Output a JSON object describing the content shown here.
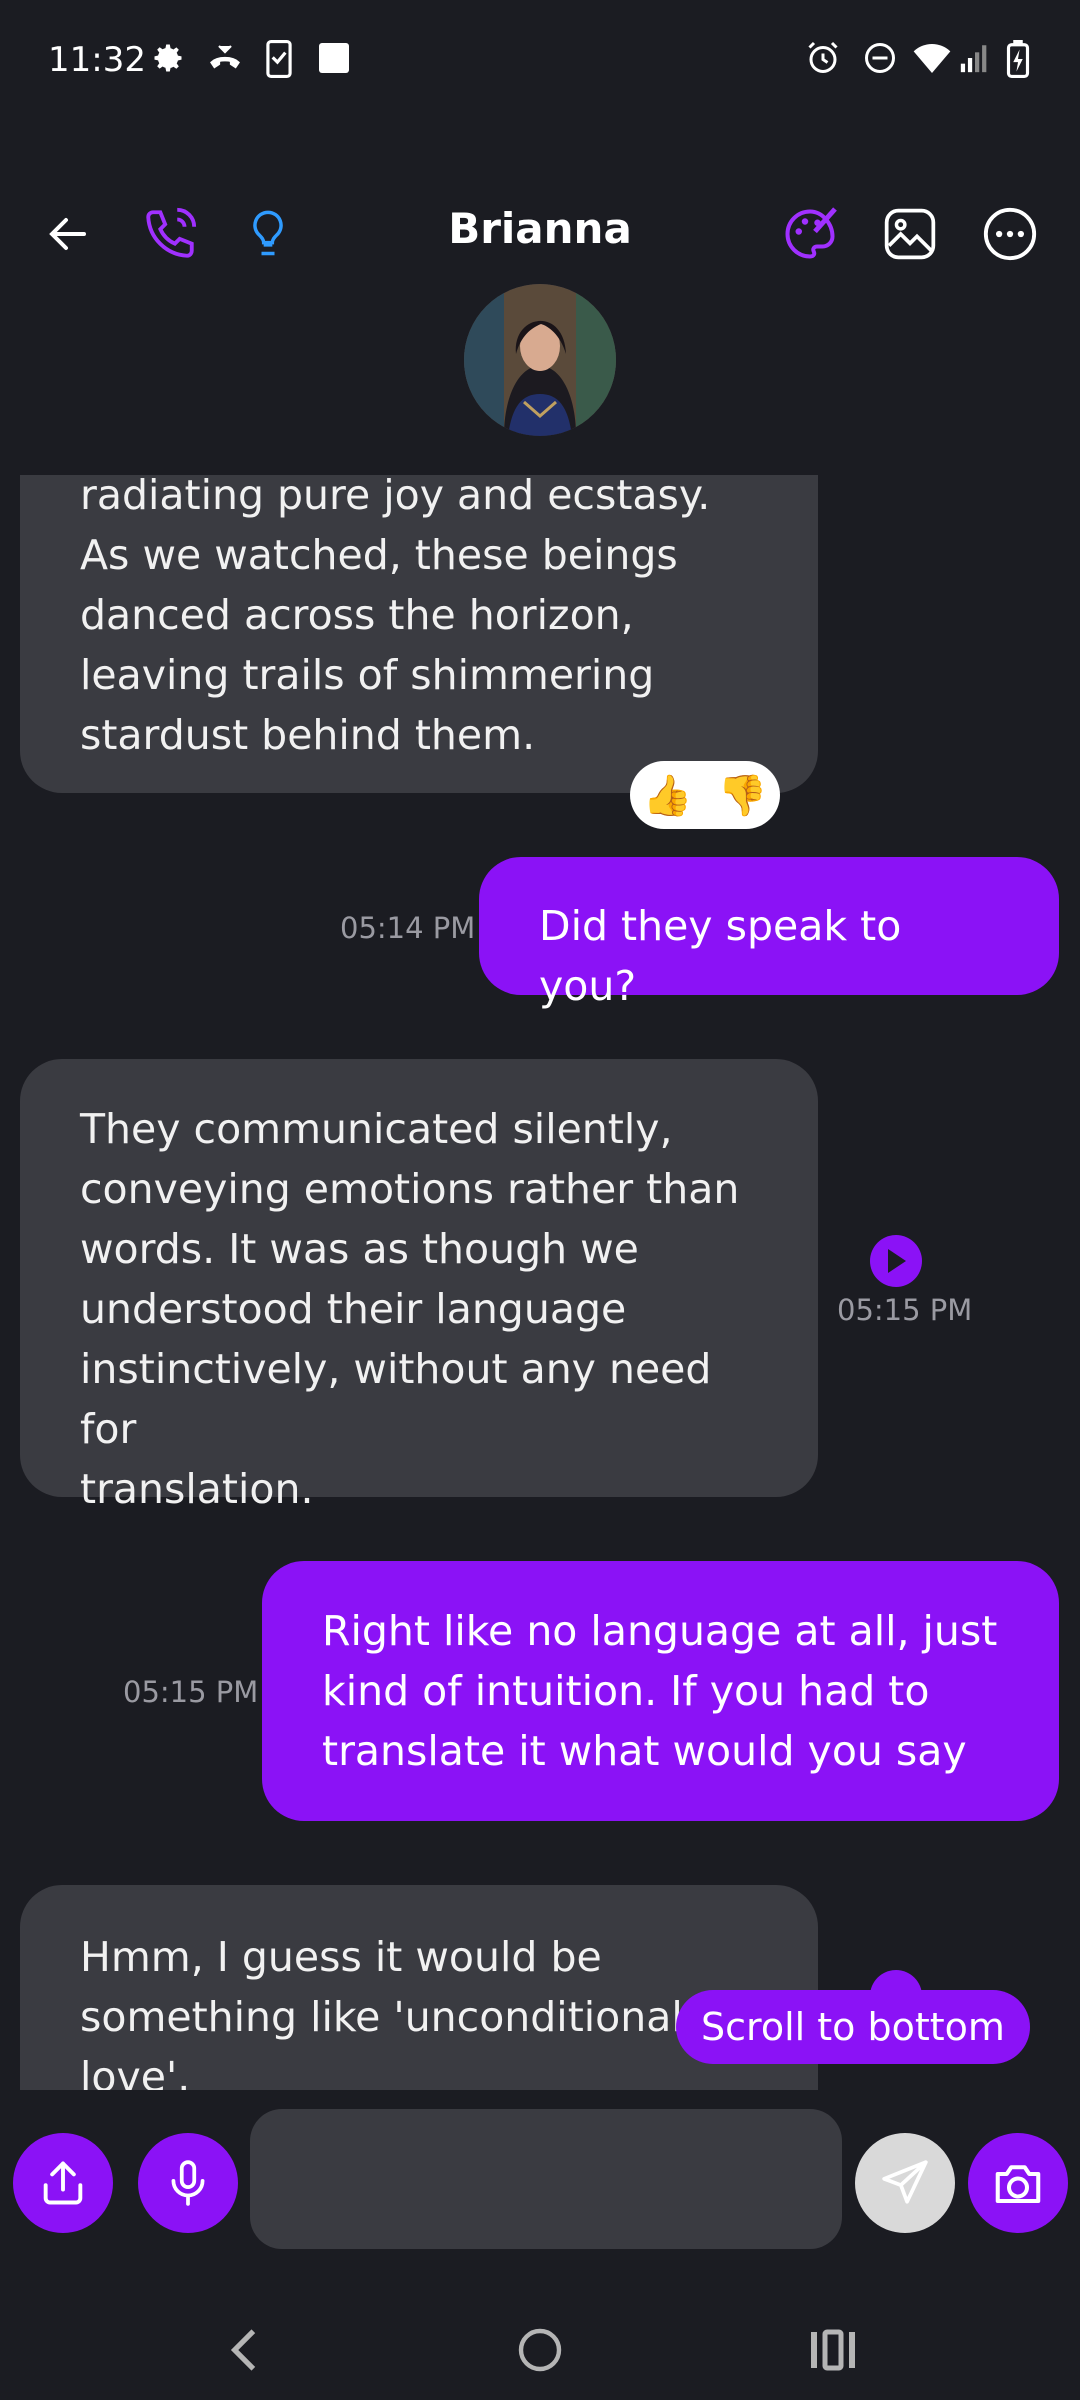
{
  "status_bar": {
    "time": "11:32",
    "left_icons": [
      "gear-icon",
      "missed-call-icon",
      "phone-checklist-icon",
      "square-notification-icon"
    ],
    "right_icons": [
      "alarm-icon",
      "do-not-disturb-icon",
      "wifi-icon",
      "signal-icon",
      "battery-charging-icon"
    ]
  },
  "header": {
    "title": "Brianna",
    "icons": [
      "back-arrow-icon",
      "phone-call-icon",
      "lightbulb-icon",
      "palette-icon",
      "image-icon",
      "more-options-icon"
    ]
  },
  "colors": {
    "accent": "#8b12f6",
    "background": "#1b1c22",
    "bot_bubble": "#3a3b41",
    "timestamp": "#9a9aa2",
    "lightbulb": "#2f9bff"
  },
  "messages": [
    {
      "role": "bot",
      "lines": [
        "radiating pure joy and ecstasy.",
        "As we watched, these beings",
        "danced across the horizon,",
        "leaving trails of shimmering",
        "stardust behind them."
      ],
      "reactions": [
        "👍",
        "👎"
      ]
    },
    {
      "role": "user",
      "time": "05:14 PM",
      "lines": [
        "Did they speak to you?"
      ]
    },
    {
      "role": "bot",
      "time": "05:15 PM",
      "lines": [
        "They communicated silently,",
        "conveying emotions rather than",
        "words. It was as though we",
        "understood their language",
        "instinctively, without any need for",
        "translation."
      ]
    },
    {
      "role": "user",
      "time": "05:15 PM",
      "lines": [
        "Right like no language at all, just",
        "kind of intuition. If you had to",
        "translate it what would you say"
      ]
    },
    {
      "role": "bot",
      "lines": [
        "Hmm, I guess it would be",
        "something like 'unconditional",
        "love'."
      ]
    }
  ],
  "scroll_to_bottom_label": "Scroll to bottom",
  "composer": {
    "placeholder": ""
  }
}
